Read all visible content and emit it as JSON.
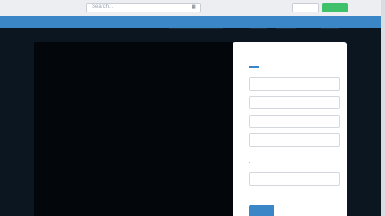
{
  "topbar": {
    "search_placeholder": "Search...",
    "search_icon": "search-icon"
  },
  "form": {
    "fields": [
      {
        "placeholder": ""
      },
      {
        "placeholder": ""
      },
      {
        "placeholder": ""
      },
      {
        "placeholder": ""
      },
      {
        "placeholder": ""
      }
    ]
  },
  "colors": {
    "accent": "#3a86c6",
    "cta_green": "#3fc06a",
    "background": "#0c1822"
  }
}
